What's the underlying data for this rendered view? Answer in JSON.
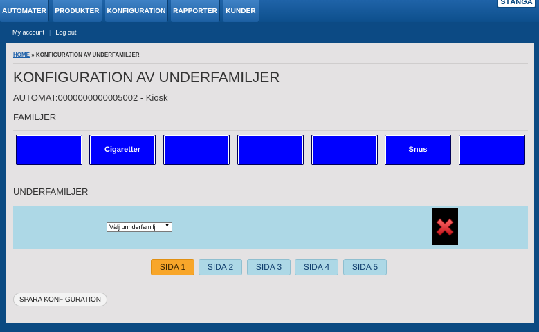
{
  "nav": {
    "tabs": [
      "AUTOMATER",
      "PRODUKTER",
      "KONFIGURATION",
      "RAPPORTER",
      "KUNDER"
    ],
    "close_label": "STÄNGA"
  },
  "account": {
    "my_account": "My account",
    "logout": "Log out"
  },
  "breadcrumb": {
    "home": "HOME",
    "separator": "»",
    "current": "KONFIGURATION AV UNDERFAMILJER"
  },
  "page": {
    "title": "KONFIGURATION AV UNDERFAMILJER",
    "machine": "AUTOMAT:0000000000005002 - Kiosk"
  },
  "families": {
    "heading": "FAMILJER",
    "items": [
      "",
      "Cigaretter",
      "",
      "",
      "",
      "Snus",
      ""
    ]
  },
  "subfamilies": {
    "heading": "UNDERFAMILJER",
    "select_value": "Välj unnderfamilj"
  },
  "pagination": {
    "pages": [
      "SIDA 1",
      "SIDA 2",
      "SIDA 3",
      "SIDA 4",
      "SIDA 5"
    ],
    "active_index": 0
  },
  "save_label": "SPARA KONFIGURATION",
  "colors": {
    "family_button": "#0000ff",
    "subfamily_box": "#add8e6",
    "active_page": "#f8a62a",
    "delete_icon": "#e0262b"
  }
}
